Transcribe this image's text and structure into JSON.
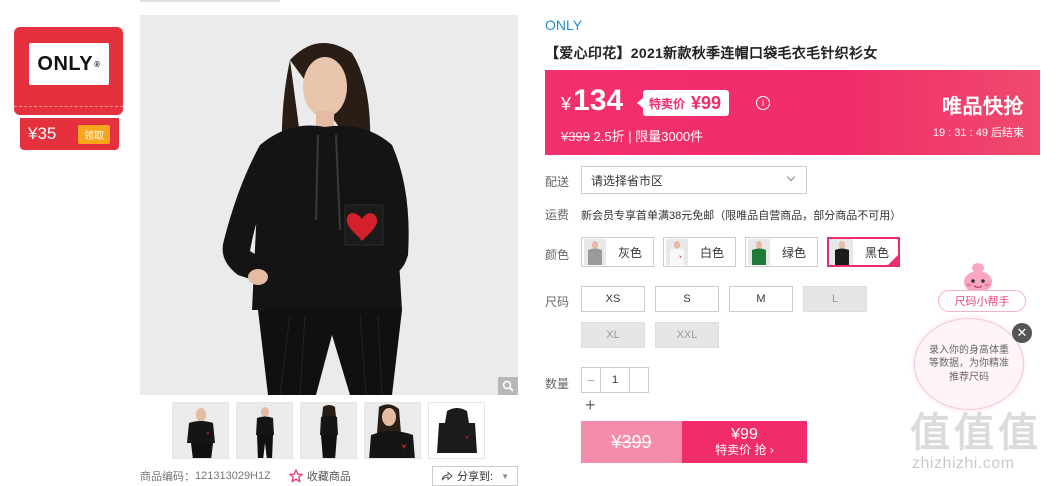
{
  "store": {
    "logo_text": "ONLY",
    "coupon_amount": "¥35",
    "coupon_button": "领取"
  },
  "product": {
    "brand": "ONLY",
    "title": "【爱心印花】2021新款秋季连帽口袋毛衣毛针织衫女",
    "code_label": "商品编码：",
    "code_value": "121313029H1Z",
    "favorite_label": "收藏商品",
    "share_label": "分享到:"
  },
  "price": {
    "currency": "¥",
    "current": "134",
    "special_label": "特卖价",
    "special_value": "¥99",
    "original": "¥399",
    "discount": "2.5折",
    "limit": "| 限量3000件",
    "flash_title": "唯品快抢",
    "countdown": "19 : 31 : 49",
    "countdown_suffix": "后结束",
    "banner_color": "#f02d6a"
  },
  "delivery": {
    "label": "配送",
    "placeholder": "请选择省市区"
  },
  "shipping": {
    "label": "运费",
    "text": "新会员专享首单满38元免邮（限唯品自营商品，部分商品不可用）"
  },
  "colors": {
    "label": "颜色",
    "options": [
      {
        "name": "灰色",
        "swatch": "#9a9a9a",
        "selected": false
      },
      {
        "name": "白色",
        "swatch": "#f4f4f4",
        "selected": false
      },
      {
        "name": "绿色",
        "swatch": "#1f7a3a",
        "selected": false
      },
      {
        "name": "黑色",
        "swatch": "#1c1c1c",
        "selected": true
      }
    ]
  },
  "sizes": {
    "label": "尺码",
    "options": [
      {
        "name": "XS",
        "available": true
      },
      {
        "name": "S",
        "available": true
      },
      {
        "name": "M",
        "available": true
      },
      {
        "name": "L",
        "available": false
      },
      {
        "name": "XL",
        "available": false
      },
      {
        "name": "XXL",
        "available": false
      }
    ]
  },
  "quantity": {
    "label": "数量",
    "value": "1",
    "minus": "−",
    "plus": "+"
  },
  "buy": {
    "original": "¥399",
    "special_value": "¥99",
    "special_label": "特卖价 抢",
    "arrow": "›"
  },
  "size_helper": {
    "title": "尺码小帮手",
    "message": "录入你的身高体重等数据，为你精准推荐尺码",
    "close": "✕"
  },
  "watermark": {
    "glyphs": "值值值",
    "site": "zhizhizhi.com"
  }
}
